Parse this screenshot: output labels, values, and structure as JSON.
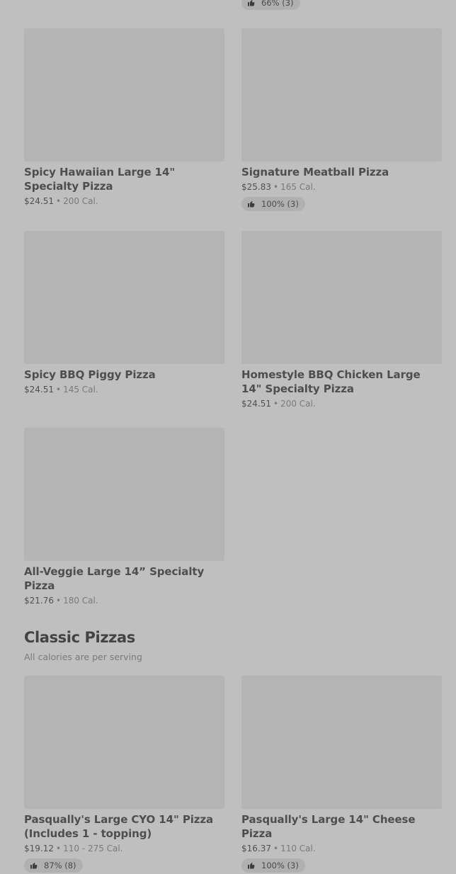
{
  "top_partial_rating": "66% (3)",
  "items": [
    {
      "name": "Spicy Hawaiian Large 14\" Specialty Pizza",
      "price": "$24.51",
      "calories": "200 Cal."
    },
    {
      "name": "Signature Meatball Pizza",
      "price": "$25.83",
      "calories": "165 Cal.",
      "rating": "100% (3)"
    },
    {
      "name": "Spicy BBQ Piggy Pizza",
      "price": "$24.51",
      "calories": "145 Cal."
    },
    {
      "name": "Homestyle BBQ Chicken Large 14\" Specialty Pizza",
      "price": "$24.51",
      "calories": "200 Cal."
    },
    {
      "name": "All-Veggie Large 14” Specialty Pizza",
      "price": "$21.76",
      "calories": "180 Cal."
    }
  ],
  "classic_section": {
    "title": "Classic Pizzas",
    "subtitle": "All calories are per serving",
    "items": [
      {
        "name": "Pasqually's Large CYO 14\" Pizza (Includes 1 - topping)",
        "price": "$19.12",
        "calories": "110 - 275 Cal.",
        "rating": "87% (8)"
      },
      {
        "name": "Pasqually's Large 14\" Cheese Pizza",
        "price": "$16.37",
        "calories": "110 Cal.",
        "rating": "100% (3)"
      }
    ]
  },
  "icons": {
    "rating": "thumbs-up-icon"
  },
  "colors": {
    "background": "#bfbfbf",
    "image_placeholder": "#b4b4b4",
    "rating_pill": "#b0b0b0"
  }
}
